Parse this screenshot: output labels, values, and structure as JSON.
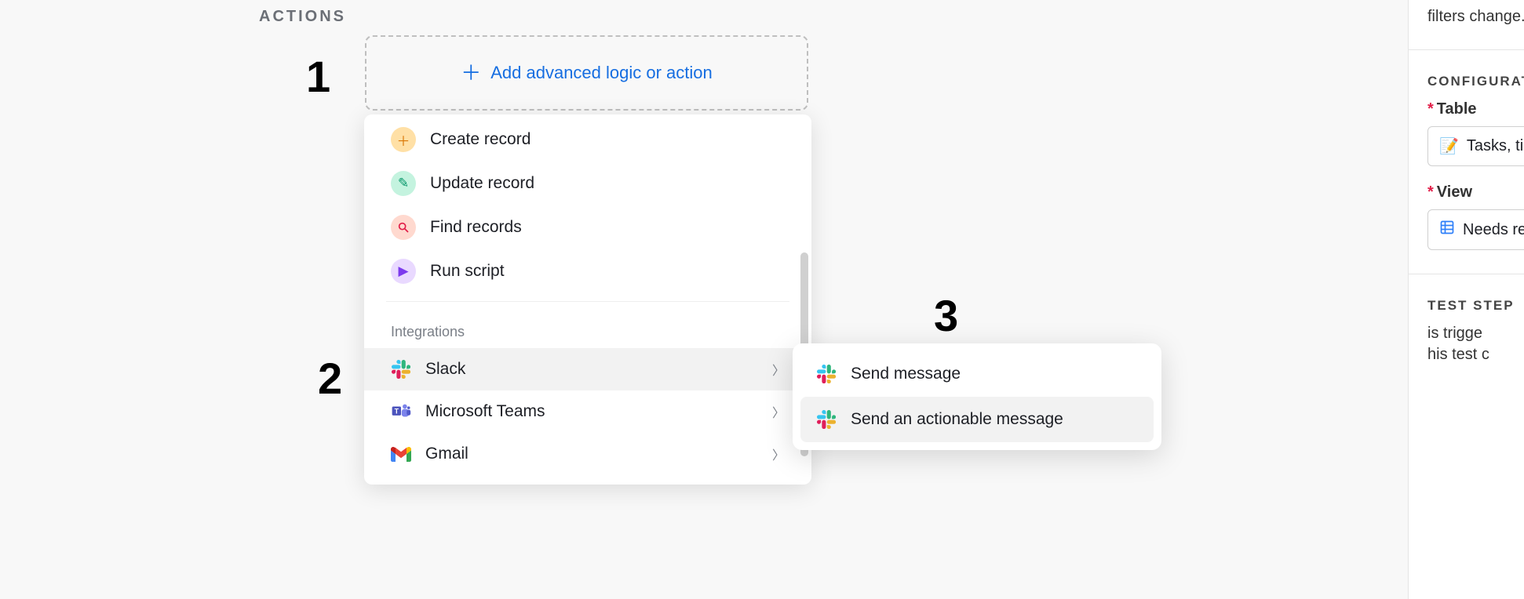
{
  "header": {
    "actions_label": "ACTIONS"
  },
  "step_numbers": {
    "one": "1",
    "two": "2",
    "three": "3"
  },
  "add_box": {
    "label": "Add advanced logic or action"
  },
  "actions_menu": {
    "builtins": {
      "create": "Create record",
      "update": "Update record",
      "find": "Find records",
      "run": "Run script"
    },
    "integrations_header": "Integrations",
    "integrations": {
      "slack": "Slack",
      "msteams": "Microsoft Teams",
      "gmail": "Gmail"
    }
  },
  "slack_submenu": {
    "send": "Send message",
    "send_actionable": "Send an actionable message"
  },
  "right_panel": {
    "intro_fragment": "filters change.",
    "config_header": "CONFIGURATIO",
    "table_label": "Table",
    "table_value": "Tasks, time",
    "view_label": "View",
    "view_value": "Needs rev",
    "test_header": "TEST STEP",
    "test_line1": "is trigge",
    "test_line2": "his test c"
  },
  "icons": {
    "memo": "📝",
    "grid": "▦",
    "gmail": "M"
  }
}
